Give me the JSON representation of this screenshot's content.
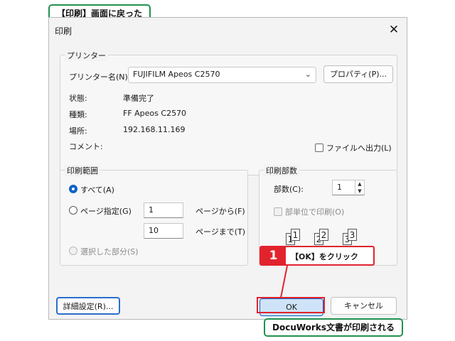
{
  "annotations": {
    "top_label": "【印刷】画面に戻った",
    "step_number": "1",
    "step_text": "【OK】をクリック",
    "bottom_label": "DocuWorks文書が印刷される"
  },
  "dialog": {
    "title": "印刷",
    "close_glyph": "✕",
    "printer_group": {
      "label": "プリンター",
      "name_label": "プリンター名(N):",
      "selected_printer": "FUJIFILM Apeos C2570",
      "properties_button": "プロパティ(P)...",
      "status_label": "状態:",
      "status_value": "準備完了",
      "type_label": "種類:",
      "type_value": "FF Apeos C2570",
      "location_label": "場所:",
      "location_value": "192.168.11.169",
      "comment_label": "コメント:",
      "print_to_file_label": "ファイルへ出力(L)"
    },
    "range_group": {
      "label": "印刷範囲",
      "all_label": "すべて(A)",
      "pages_label": "ページ指定(G)",
      "from_value": "1",
      "from_label": "ページから(F)",
      "to_value": "10",
      "to_label": "ページまで(T)",
      "selection_label": "選択した部分(S)"
    },
    "copies_group": {
      "label": "印刷部数",
      "count_label": "部数(C):",
      "count_value": "1",
      "collate_label": "部単位で印刷(O)",
      "icon_numbers": [
        "1",
        "1",
        "2",
        "2",
        "3",
        "3"
      ]
    },
    "advanced_button": "詳細設定(R)...",
    "ok_button": "OK",
    "cancel_button": "キャンセル"
  }
}
